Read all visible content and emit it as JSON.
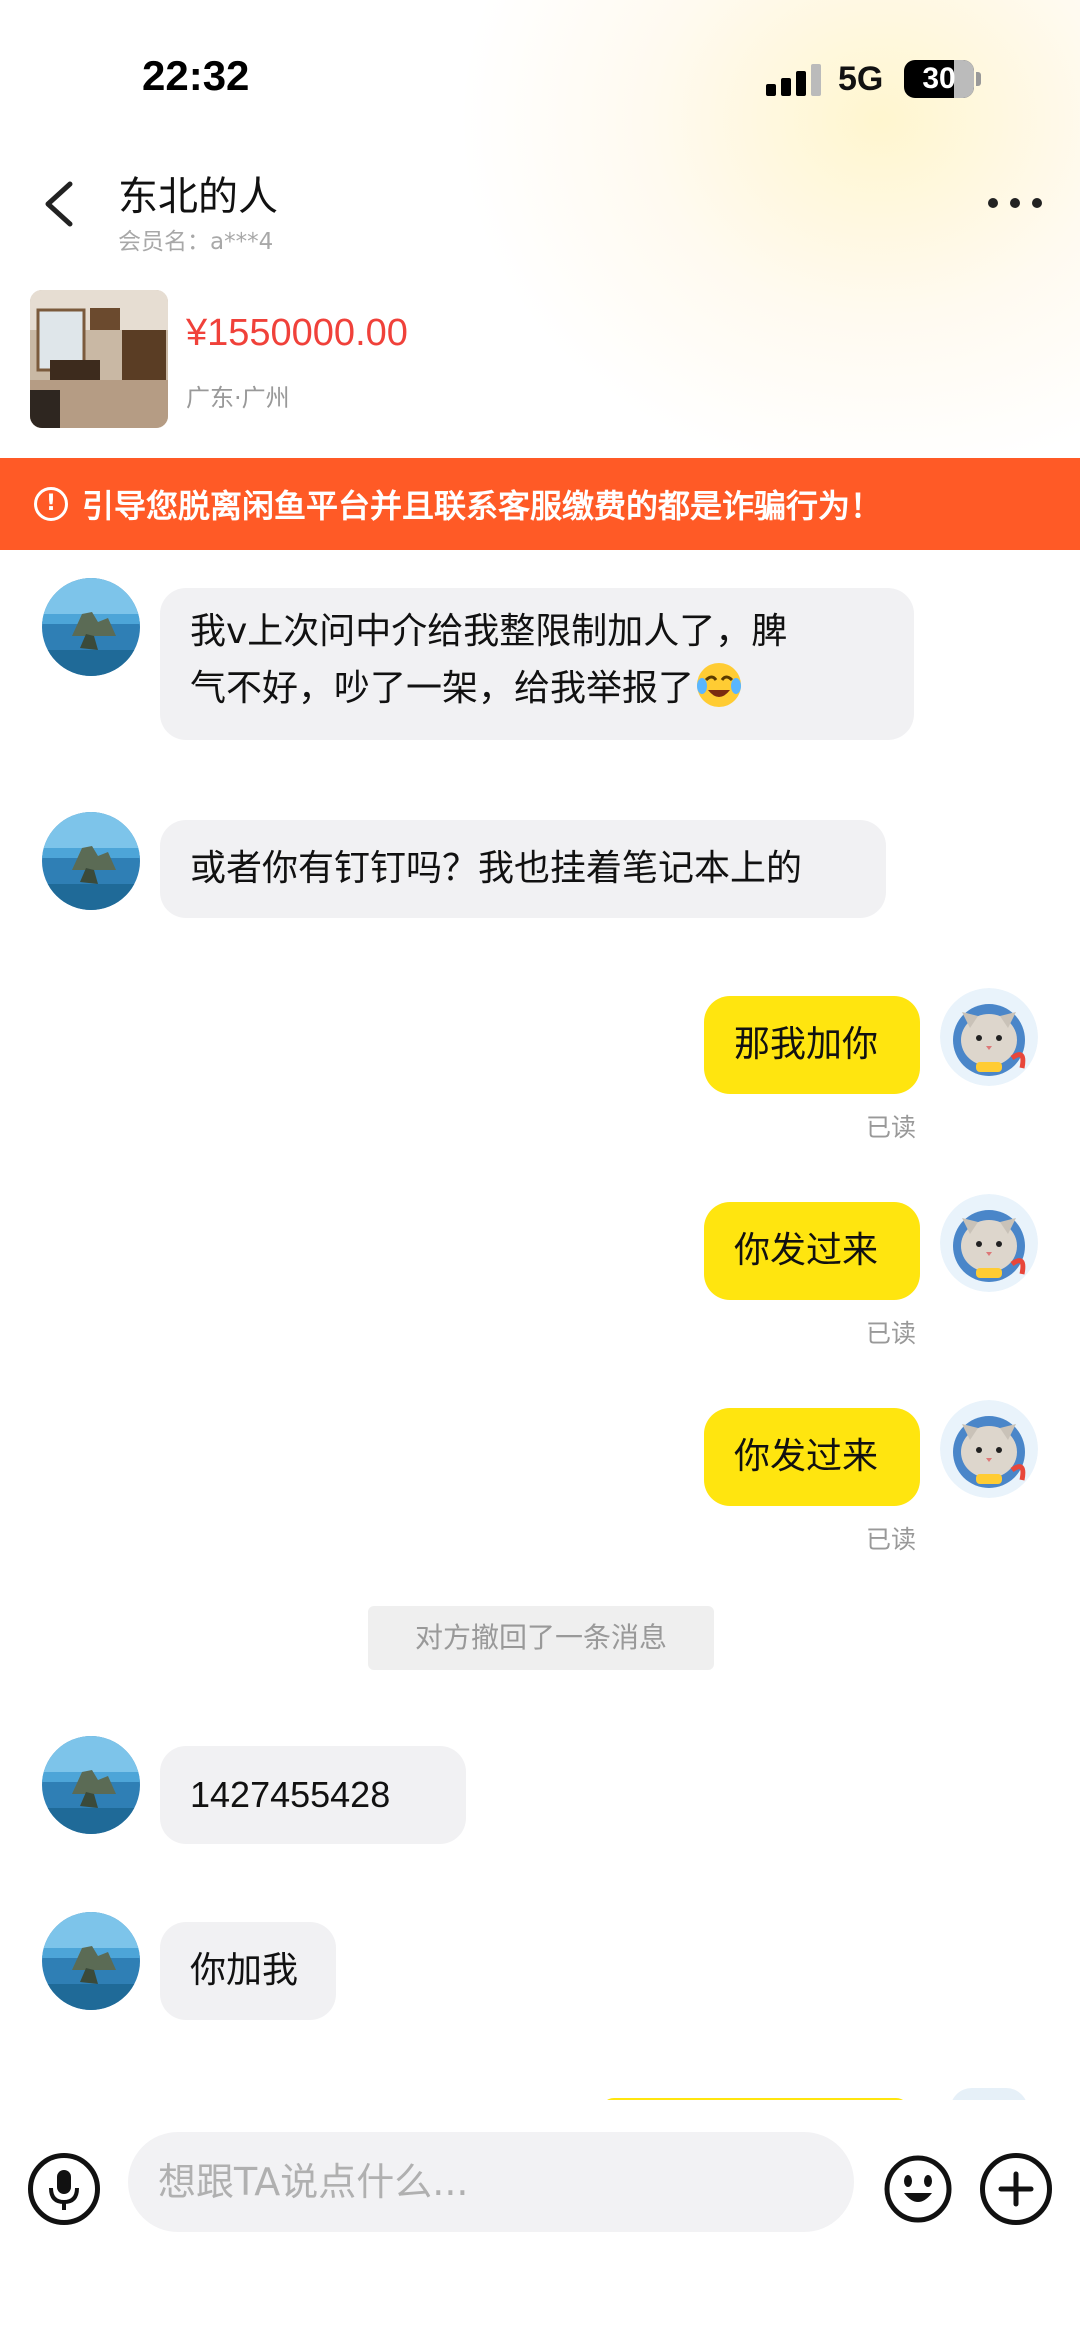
{
  "status_bar": {
    "time": "22:32",
    "network": "5G",
    "battery": "30"
  },
  "header": {
    "title": "东北的人",
    "subtitle": "会员名：a***4"
  },
  "product": {
    "price": "¥1550000.00",
    "location": "广东·广州"
  },
  "warning": {
    "text": "引导您脱离闲鱼平台并且联系客服缴费的都是诈骗行为！"
  },
  "messages": [
    {
      "side": "left",
      "line1": "我v上次问中介给我整限制加人了，脾",
      "line2": "气不好，吵了一架，给我举报了"
    },
    {
      "side": "left",
      "text": "或者你有钉钉吗？我也挂着笔记本上的"
    },
    {
      "side": "right",
      "text": "那我加你",
      "status": "已读"
    },
    {
      "side": "right",
      "text": "你发过来",
      "status": "已读"
    },
    {
      "side": "right",
      "text": "你发过来",
      "status": "已读"
    },
    {
      "side": "system",
      "text": "对方撤回了一条消息"
    },
    {
      "side": "left",
      "text": "1427455428"
    },
    {
      "side": "left",
      "text": "你加我"
    }
  ],
  "input": {
    "placeholder": "想跟TA说点什么..."
  },
  "icons": {
    "back": "chevron-left-icon",
    "more": "more-icon",
    "mic": "microphone-icon",
    "emoji": "emoji-icon",
    "plus": "plus-icon",
    "warning": "alert-icon"
  },
  "colors": {
    "accent_yellow": "#ffe50f",
    "warning_orange": "#ff5a26",
    "price_red": "#f0413a"
  }
}
